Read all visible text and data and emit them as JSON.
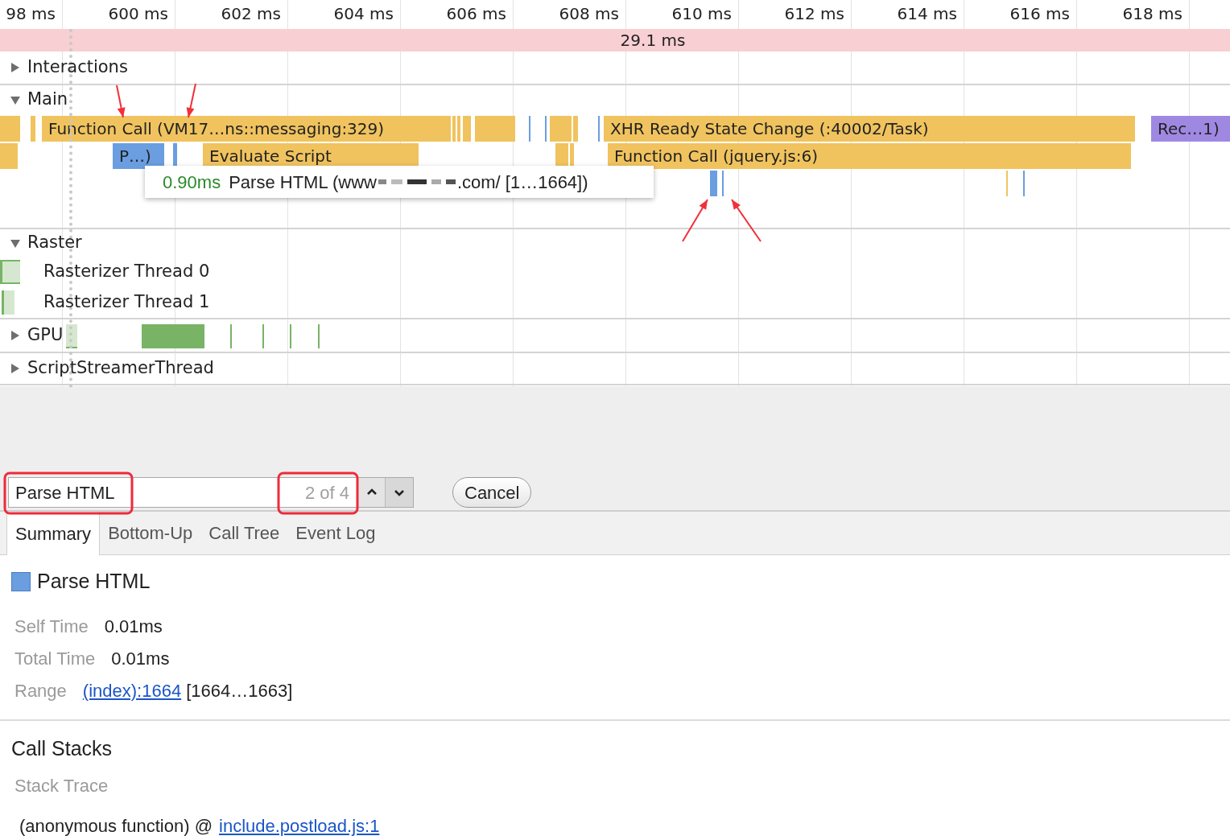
{
  "ruler": {
    "ticks": [
      "98 ms",
      "600 ms",
      "602 ms",
      "604 ms",
      "606 ms",
      "608 ms",
      "610 ms",
      "612 ms",
      "614 ms",
      "616 ms",
      "618 ms"
    ]
  },
  "frame": {
    "duration": "29.1 ms"
  },
  "tracks": [
    {
      "kind": "interactions",
      "label": "Interactions",
      "expanded": false
    },
    {
      "kind": "main",
      "label": "Main",
      "expanded": true,
      "lanes": [
        {
          "events": [
            {
              "label": "Function Call (VM17…ns::messaging:329)",
              "kind": "scripting",
              "selected": false
            },
            {
              "label": "XHR Ready State Change (:40002/Task)",
              "kind": "scripting",
              "selected": false
            },
            {
              "label": "Rec…1)",
              "kind": "rendering",
              "selected": false
            }
          ]
        },
        {
          "events": [
            {
              "label": "P…)",
              "kind": "loading",
              "selected": true
            },
            {
              "label": "Evaluate Script",
              "kind": "scripting",
              "selected": false
            },
            {
              "label": "Function Call (jquery.js:6)",
              "kind": "scripting",
              "selected": false
            }
          ]
        }
      ]
    },
    {
      "kind": "raster",
      "label": "Raster",
      "expanded": true,
      "children": [
        {
          "label": "Rasterizer Thread 0"
        },
        {
          "label": "Rasterizer Thread 1"
        }
      ]
    },
    {
      "kind": "gpu",
      "label": "GPU",
      "expanded": false
    },
    {
      "kind": "streamer",
      "label": "ScriptStreamerThread",
      "expanded": false
    }
  ],
  "tooltip": {
    "duration": "0.90ms",
    "text_start": "Parse HTML (www",
    "text_end": ".com/ [1…1664])"
  },
  "search": {
    "value": "Parse HTML",
    "match_count": "2 of 4",
    "cancel": "Cancel"
  },
  "tabs": [
    {
      "label": "Summary",
      "selected": true
    },
    {
      "label": "Bottom-Up",
      "selected": false
    },
    {
      "label": "Call Tree",
      "selected": false
    },
    {
      "label": "Event Log",
      "selected": false
    }
  ],
  "summary": {
    "title": "Parse HTML",
    "rows": [
      {
        "label": "Self Time",
        "value": "0.01ms"
      },
      {
        "label": "Total Time",
        "value": "0.01ms"
      },
      {
        "label": "Range",
        "link": "(index):1664",
        "value": "[1664…1663]"
      }
    ]
  },
  "call_stacks": {
    "title": "Call Stacks",
    "subtitle": "Stack Trace",
    "frames": [
      {
        "function": "(anonymous function) @",
        "link": "include.postload.js:1"
      }
    ]
  }
}
